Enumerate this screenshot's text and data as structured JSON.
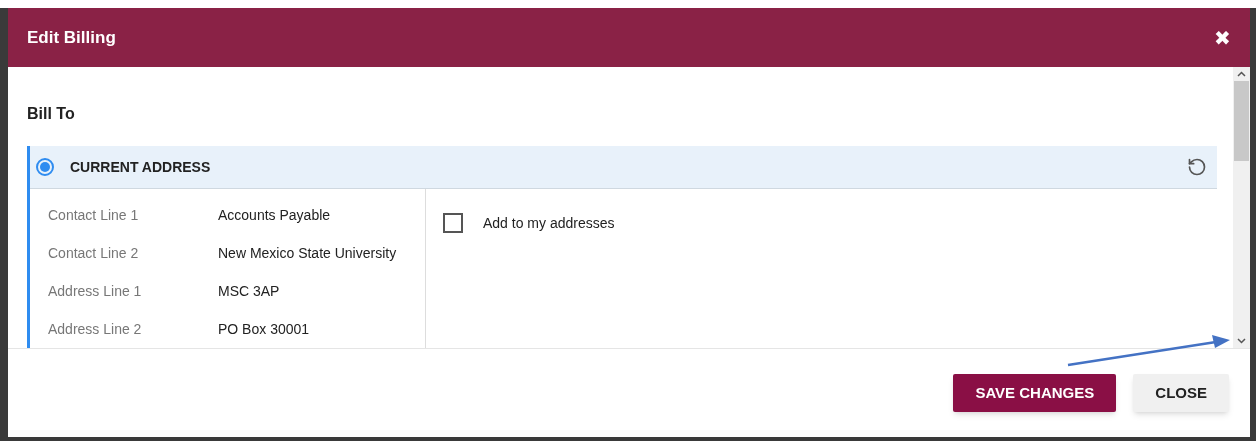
{
  "dialog": {
    "title": "Edit Billing",
    "close_icon": "✖"
  },
  "section": {
    "title": "Bill To"
  },
  "address_option": {
    "label": "CURRENT ADDRESS",
    "selected": true,
    "fields": [
      {
        "label": "Contact Line 1",
        "value": "Accounts Payable"
      },
      {
        "label": "Contact Line 2",
        "value": "New Mexico State University"
      },
      {
        "label": "Address Line 1",
        "value": "MSC 3AP"
      },
      {
        "label": "Address Line 2",
        "value": "PO Box 30001"
      }
    ],
    "add_to_addresses": {
      "label": "Add to my addresses",
      "checked": false
    }
  },
  "buttons": [
    {
      "label": "SAVE CHANGES",
      "kind": "primary"
    },
    {
      "label": "CLOSE",
      "kind": "secondary"
    }
  ]
}
